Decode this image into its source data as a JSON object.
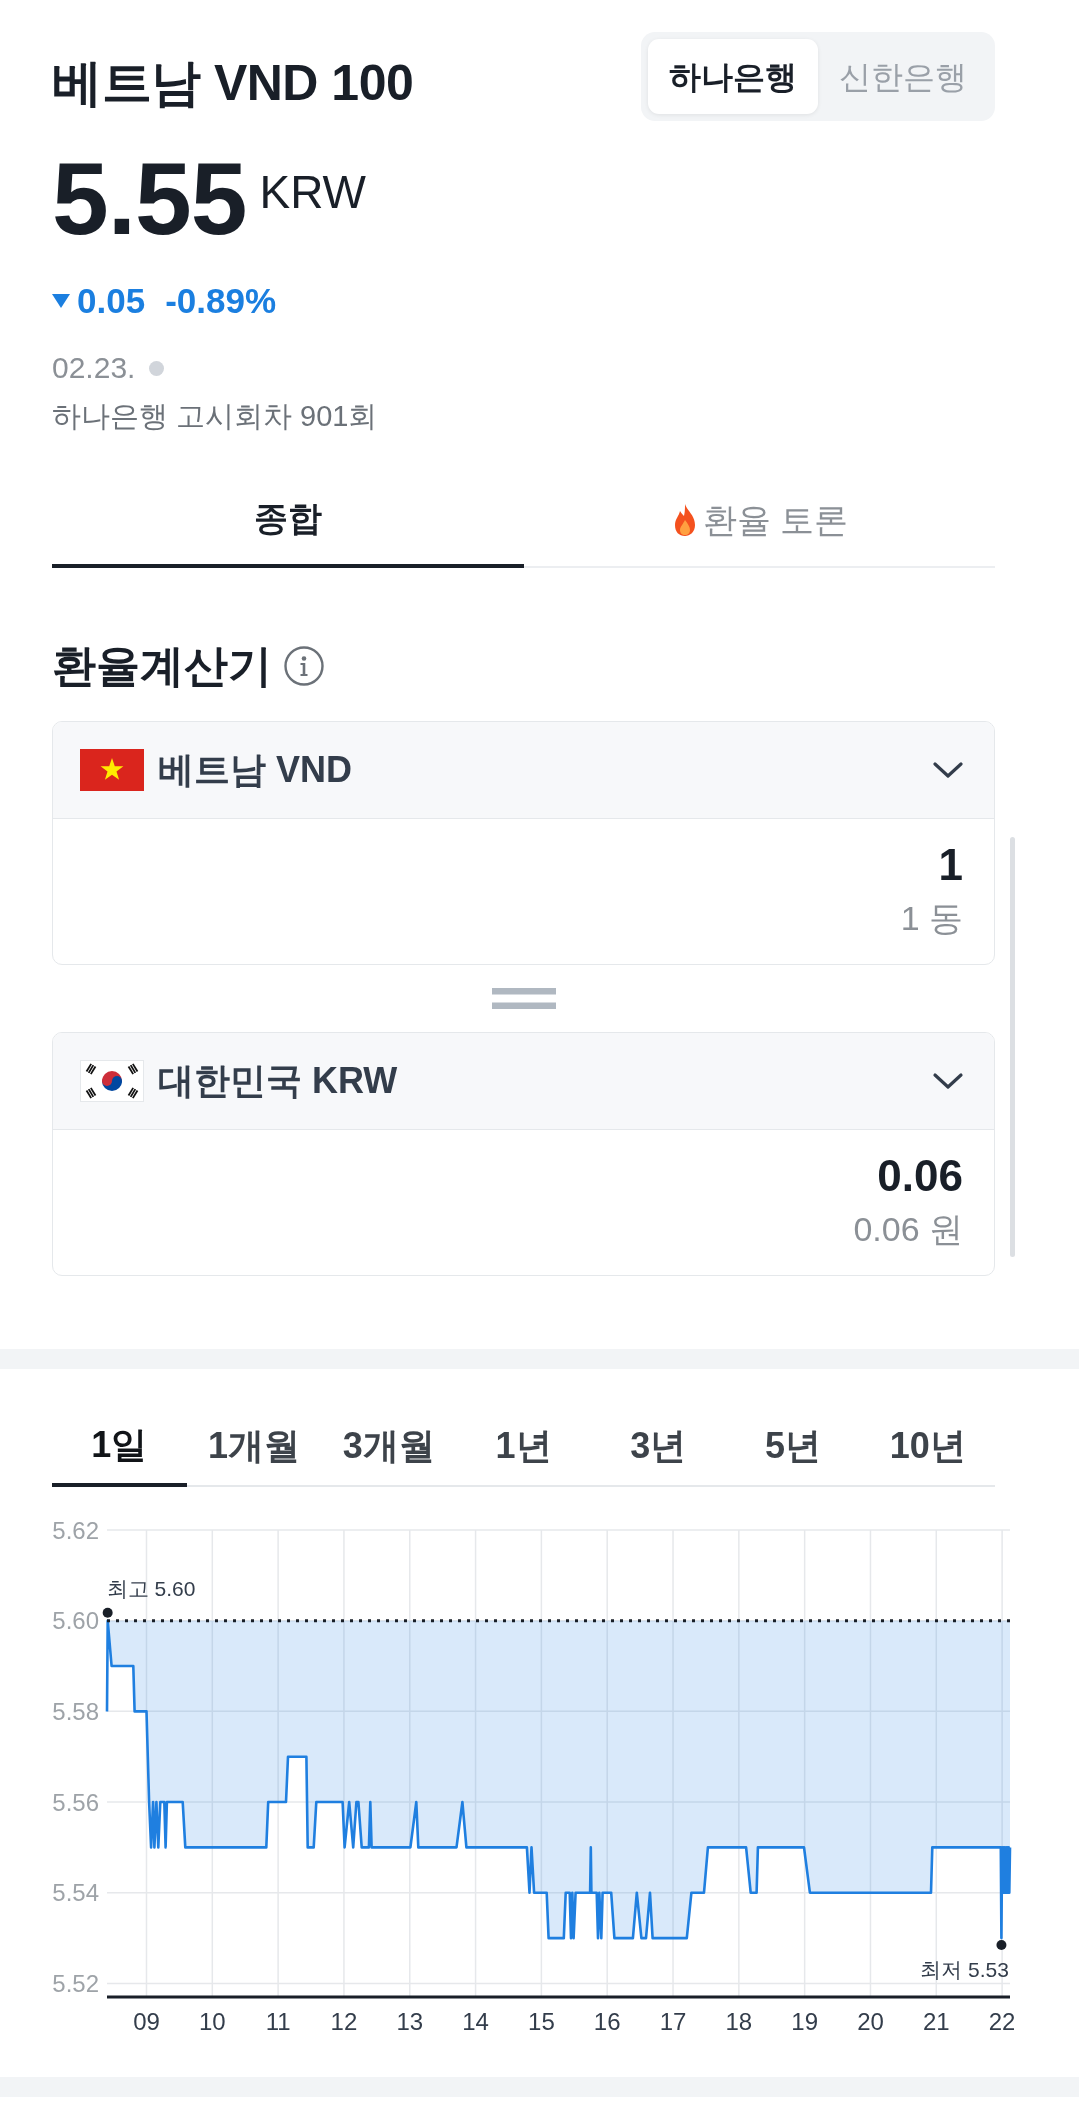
{
  "header": {
    "title": "베트남 VND 100",
    "banks": [
      {
        "label": "하나은행",
        "selected": true
      },
      {
        "label": "신한은행",
        "selected": false
      }
    ]
  },
  "quote": {
    "price": "5.55",
    "currency": "KRW",
    "change": {
      "falling": true,
      "amount": "0.05",
      "percent": "-0.89%"
    },
    "date": "02.23.",
    "live": false,
    "notice": "하나은행 고시회차 901회"
  },
  "tabs": [
    {
      "label": "종합",
      "selected": true,
      "hot": false
    },
    {
      "label": "환율 토론",
      "selected": false,
      "hot": true
    }
  ],
  "calculator": {
    "title": "환율계산기",
    "currencies": [
      {
        "kind": "vietnam",
        "name": "베트남 VND",
        "amount": "1",
        "amount_text": "1 동"
      },
      {
        "kind": "korea",
        "name": "대한민국 KRW",
        "amount": "0.06",
        "amount_text": "0.06 원"
      }
    ]
  },
  "chart": {
    "periods": [
      {
        "label": "1일",
        "selected": true
      },
      {
        "label": "1개월",
        "selected": false
      },
      {
        "label": "3개월",
        "selected": false
      },
      {
        "label": "1년",
        "selected": false
      },
      {
        "label": "3년",
        "selected": false
      },
      {
        "label": "5년",
        "selected": false
      },
      {
        "label": "10년",
        "selected": false
      }
    ],
    "chart_data": {
      "type": "line",
      "grid": true,
      "x": [
        8.4,
        8.41,
        8.47,
        8.8,
        8.82,
        9.0,
        9.02,
        9.04,
        9.07,
        9.1,
        9.12,
        9.15,
        9.18,
        9.21,
        9.27,
        9.29,
        9.31,
        9.55,
        9.59,
        10.82,
        10.85,
        11.12,
        11.15,
        11.43,
        11.45,
        11.54,
        11.58,
        11.98,
        12.01,
        12.08,
        12.14,
        12.19,
        12.22,
        12.27,
        12.38,
        12.4,
        12.42,
        13.01,
        13.1,
        13.13,
        13.71,
        13.8,
        13.86,
        14.78,
        14.82,
        14.85,
        14.89,
        15.08,
        15.11,
        15.34,
        15.37,
        15.43,
        15.45,
        15.47,
        15.49,
        15.52,
        15.74,
        15.75,
        15.76,
        15.84,
        15.86,
        15.88,
        15.91,
        15.93,
        16.06,
        16.11,
        16.39,
        16.45,
        16.52,
        16.59,
        16.65,
        16.69,
        17.21,
        17.28,
        17.47,
        17.53,
        18.11,
        18.18,
        18.27,
        18.29,
        18.99,
        19.08,
        20.92,
        20.94,
        21.98,
        21.99,
        22.0,
        22.01,
        22.02,
        22.03,
        22.04,
        22.05,
        22.06,
        22.07,
        22.08,
        22.09,
        22.1,
        22.11,
        22.12
      ],
      "series": [
        {
          "color": "#1f7fe0",
          "values": [
            5.58,
            5.6,
            5.59,
            5.59,
            5.58,
            5.58,
            5.57,
            5.56,
            5.55,
            5.56,
            5.55,
            5.56,
            5.55,
            5.56,
            5.56,
            5.55,
            5.56,
            5.56,
            5.55,
            5.55,
            5.56,
            5.56,
            5.57,
            5.57,
            5.55,
            5.55,
            5.56,
            5.56,
            5.55,
            5.56,
            5.55,
            5.56,
            5.56,
            5.55,
            5.55,
            5.56,
            5.55,
            5.55,
            5.56,
            5.55,
            5.55,
            5.56,
            5.55,
            5.55,
            5.54,
            5.55,
            5.54,
            5.54,
            5.53,
            5.53,
            5.54,
            5.54,
            5.53,
            5.54,
            5.53,
            5.54,
            5.54,
            5.55,
            5.54,
            5.54,
            5.53,
            5.54,
            5.53,
            5.54,
            5.54,
            5.53,
            5.53,
            5.54,
            5.53,
            5.53,
            5.54,
            5.53,
            5.53,
            5.54,
            5.54,
            5.55,
            5.55,
            5.54,
            5.54,
            5.55,
            5.55,
            5.54,
            5.54,
            5.55,
            5.55,
            5.53,
            5.55,
            5.54,
            5.55,
            5.54,
            5.55,
            5.54,
            5.55,
            5.54,
            5.55,
            5.54,
            5.55,
            5.54,
            5.55
          ]
        }
      ],
      "xlim": [
        8.4,
        22.12
      ],
      "ylim": [
        5.517,
        5.62
      ],
      "xticks": [
        {
          "value": 9,
          "label": "09"
        },
        {
          "value": 10,
          "label": "10"
        },
        {
          "value": 11,
          "label": "11"
        },
        {
          "value": 12,
          "label": "12"
        },
        {
          "value": 13,
          "label": "13"
        },
        {
          "value": 14,
          "label": "14"
        },
        {
          "value": 15,
          "label": "15"
        },
        {
          "value": 16,
          "label": "16"
        },
        {
          "value": 17,
          "label": "17"
        },
        {
          "value": 18,
          "label": "18"
        },
        {
          "value": 19,
          "label": "19"
        },
        {
          "value": 20,
          "label": "20"
        },
        {
          "value": 21,
          "label": "21"
        },
        {
          "value": 22,
          "label": "22"
        }
      ],
      "yticks": [
        {
          "value": 5.52,
          "label": "5.52"
        },
        {
          "value": 5.54,
          "label": "5.54"
        },
        {
          "value": 5.56,
          "label": "5.56"
        },
        {
          "value": 5.58,
          "label": "5.58"
        },
        {
          "value": 5.6,
          "label": "5.60"
        },
        {
          "value": 5.62,
          "label": "5.62"
        }
      ],
      "ref_lines": [
        {
          "axis": "y",
          "value": 5.6
        }
      ],
      "annotations": [
        {
          "text": "최고 5.60"
        },
        {
          "text": "최저 5.53"
        }
      ]
    }
  }
}
